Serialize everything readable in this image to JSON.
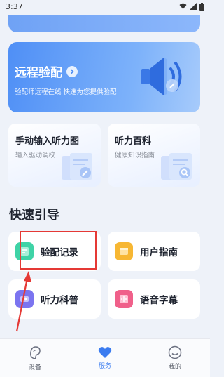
{
  "status_bar": {
    "time": "3:37"
  },
  "remote_fitting": {
    "title": "远程验配",
    "subtitle": "验配师远程在线 快速为您提供验配"
  },
  "feature_cards": [
    {
      "title": "手动输入听力图",
      "subtitle": "输入驱动调校",
      "icon": "pen-document-icon"
    },
    {
      "title": "听力百科",
      "subtitle": "健康知识指南",
      "icon": "search-document-icon"
    }
  ],
  "quick_guide": {
    "title": "快速引导",
    "items": [
      {
        "label": "验配记录",
        "icon": "record-icon",
        "color": "#3fd3a6"
      },
      {
        "label": "用户指南",
        "icon": "guide-icon",
        "color": "#f7b733"
      },
      {
        "label": "听力科普",
        "icon": "science-icon",
        "color": "#7b74f0"
      },
      {
        "label": "语音字幕",
        "icon": "voice-caption-icon",
        "color": "#f0608a"
      }
    ]
  },
  "bottom_nav": {
    "items": [
      {
        "label": "设备",
        "icon": "ear-icon"
      },
      {
        "label": "服务",
        "icon": "heart-icon",
        "active": true
      },
      {
        "label": "我的",
        "icon": "smile-icon"
      }
    ]
  },
  "colors": {
    "accent": "#3b7cf0",
    "annotation": "#e53935"
  }
}
